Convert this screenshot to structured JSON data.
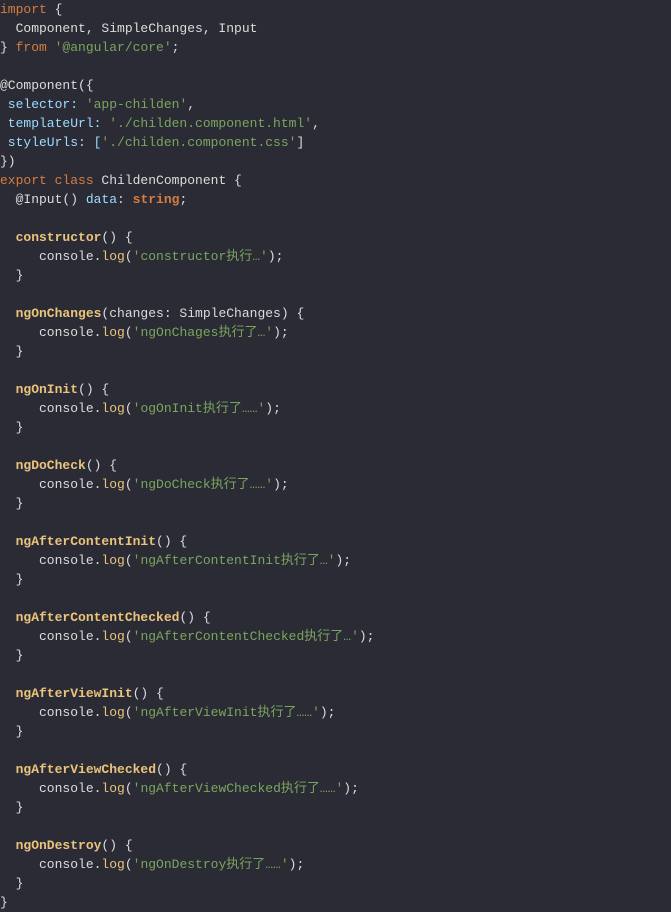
{
  "code": {
    "l1_import": "import",
    "l1_br": " {",
    "l2": "  Component, SimpleChanges, Input",
    "l3_close": "} ",
    "l3_from": "from",
    "l3_mod": " '@angular/core'",
    "l3_semi": ";",
    "l5": "@Component({",
    "l6a": " selector: ",
    "l6b": "'app-childen'",
    "l6c": ",",
    "l7a": " templateUrl: ",
    "l7b": "'./childen.component.html'",
    "l7c": ",",
    "l8a": " styleUrls: [",
    "l8b": "'./childen.component.css'",
    "l8c": "]",
    "l9": "})",
    "l10a": "export class",
    "l10b": " ChildenComponent {",
    "l11a": "  @Input() ",
    "l11b": "data",
    "l11c": ": ",
    "l11d": "string",
    "l11e": ";",
    "l13a": "  constructor",
    "l13b": "() {",
    "l14a": "     console.",
    "l14b": "log",
    "l14c": "(",
    "l14d": "'constructor执行…'",
    "l14e": ");",
    "l15": "  }",
    "l17a": "  ngOnChanges",
    "l17b": "(changes: SimpleChanges) {",
    "l18a": "     console.",
    "l18b": "log",
    "l18c": "(",
    "l18d": "'ngOnChages执行了…'",
    "l18e": ");",
    "l19": "  }",
    "l21a": "  ngOnInit",
    "l21b": "() {",
    "l22a": "     console.",
    "l22b": "log",
    "l22c": "(",
    "l22d": "'ogOnInit执行了……'",
    "l22e": ");",
    "l23": "  }",
    "l25a": "  ngDoCheck",
    "l25b": "() {",
    "l26a": "     console.",
    "l26b": "log",
    "l26c": "(",
    "l26d": "'ngDoCheck执行了……'",
    "l26e": ");",
    "l27": "  }",
    "l29a": "  ngAfterContentInit",
    "l29b": "() {",
    "l30a": "     console.",
    "l30b": "log",
    "l30c": "(",
    "l30d": "'ngAfterContentInit执行了…'",
    "l30e": ");",
    "l31": "  }",
    "l33a": "  ngAfterContentChecked",
    "l33b": "() {",
    "l34a": "     console.",
    "l34b": "log",
    "l34c": "(",
    "l34d": "'ngAfterContentChecked执行了…'",
    "l34e": ");",
    "l35": "  }",
    "l37a": "  ngAfterViewInit",
    "l37b": "() {",
    "l38a": "     console.",
    "l38b": "log",
    "l38c": "(",
    "l38d": "'ngAfterViewInit执行了……'",
    "l38e": ");",
    "l39": "  }",
    "l41a": "  ngAfterViewChecked",
    "l41b": "() {",
    "l42a": "     console.",
    "l42b": "log",
    "l42c": "(",
    "l42d": "'ngAfterViewChecked执行了……'",
    "l42e": ");",
    "l43": "  }",
    "l45a": "  ngOnDestroy",
    "l45b": "() {",
    "l46a": "     console.",
    "l46b": "log",
    "l46c": "(",
    "l46d": "'ngOnDestroy执行了……'",
    "l46e": ");",
    "l47": "  }",
    "l48": "}"
  }
}
